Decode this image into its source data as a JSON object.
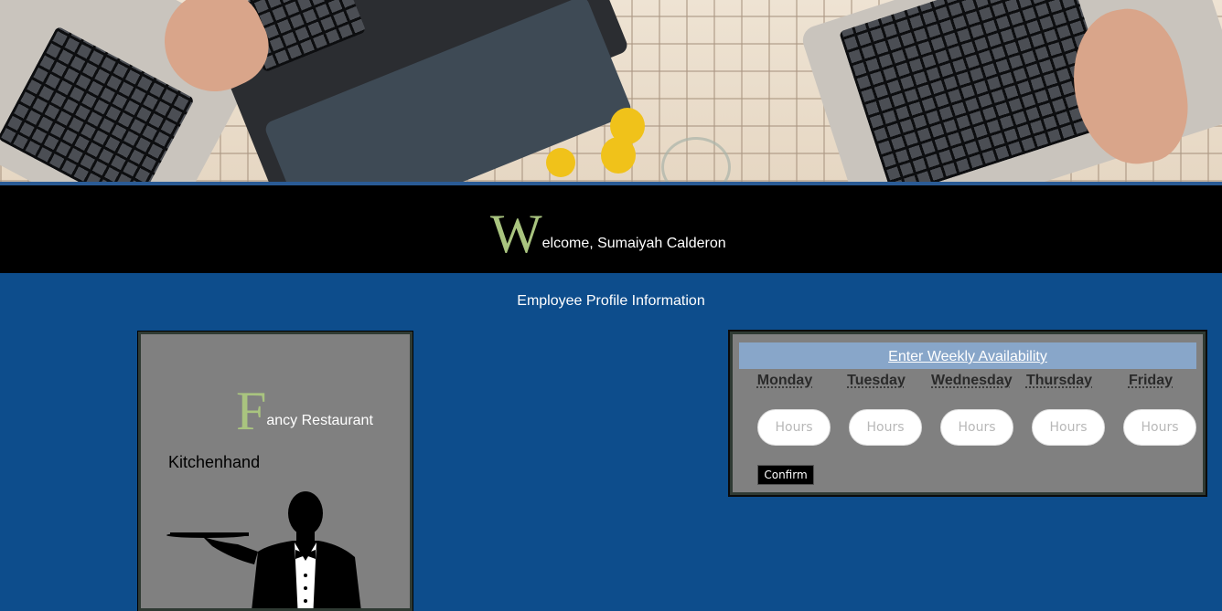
{
  "welcome": {
    "initial": "W",
    "rest": "elcome, Sumaiyah Calderon"
  },
  "section_title": "Employee Profile Information",
  "profile_card": {
    "company_initial": "F",
    "company_rest": "ancy Restaurant",
    "role": "Kitchenhand"
  },
  "availability": {
    "header_link": "Enter Weekly Availability",
    "days": [
      "Monday",
      "Tuesday",
      "Wednesday",
      "Thursday",
      "Friday"
    ],
    "hours_placeholder": "Hours",
    "confirm_label": "Confirm"
  },
  "colors": {
    "page_background": "#0d4d8c",
    "band_background": "#000000",
    "accent_initial": "#a9c47f",
    "card_background": "#808080",
    "availability_header": "#88a6c9"
  }
}
